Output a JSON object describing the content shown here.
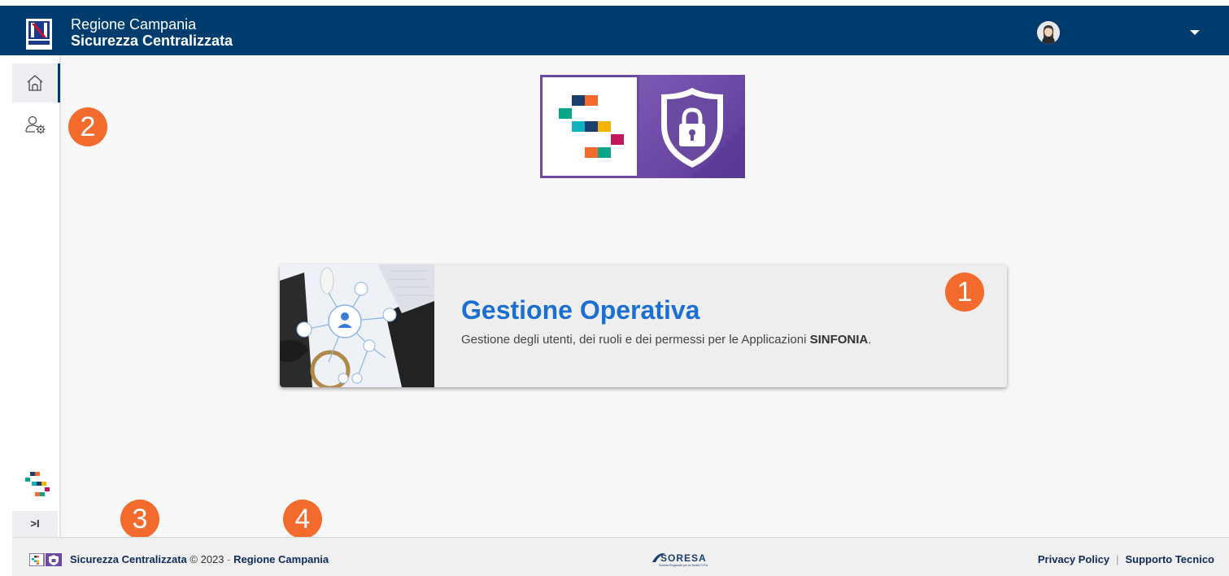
{
  "header": {
    "title_line1": "Regione Campania",
    "title_line2": "Sicurezza Centralizzata",
    "background_color": "#003d6e",
    "avatar_icon": "user-avatar-icon",
    "menu_icon": "caret-down-icon"
  },
  "sidebar": {
    "items": [
      {
        "name": "home",
        "icon": "home-icon",
        "active": true
      },
      {
        "name": "user-settings",
        "icon": "user-gear-icon",
        "active": false
      }
    ],
    "collapse_label": ">I"
  },
  "card": {
    "title": "Gestione Operativa",
    "description_prefix": "Gestione degli utenti, dei ruoli e dei permessi per le Applicazioni ",
    "description_bold": "SINFONIA",
    "description_suffix": ".",
    "title_color": "#1a6fd1"
  },
  "badges": {
    "b1": "1",
    "b2": "2",
    "b3": "3",
    "b4": "4",
    "color": "#f26a2c"
  },
  "footer": {
    "app_name": "Sicurezza Centralizzata",
    "copyright": "© 2023",
    "separator": "-",
    "region_link": "Regione Campania",
    "privacy_link": "Privacy Policy",
    "pipe": "|",
    "support_link": "Supporto Tecnico",
    "soresa_logo_text": "SORESA",
    "soresa_tagline": "Società Regionale per la Sanità S.P.A."
  }
}
